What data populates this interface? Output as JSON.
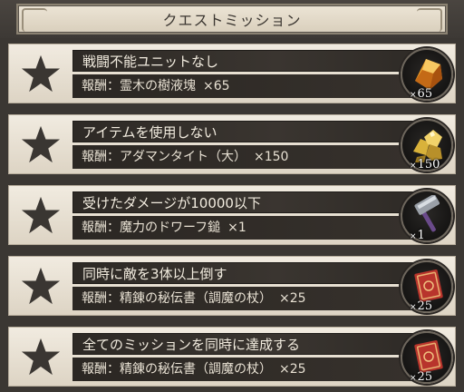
{
  "header": {
    "title": "クエストミッション"
  },
  "missions": [
    {
      "name": "戦闘不能ユニットなし",
      "reward_prefix": "報酬：",
      "reward_item": "霊木の樹液塊",
      "reward_qty": "×65",
      "icon": "amber-crystal-icon",
      "count_x": "×",
      "count": "65"
    },
    {
      "name": "アイテムを使用しない",
      "reward_prefix": "報酬：",
      "reward_item": "アダマンタイト（大）",
      "reward_qty": "×150",
      "icon": "gold-ore-icon",
      "count_x": "×",
      "count": "150"
    },
    {
      "name": "受けたダメージが10000以下",
      "reward_prefix": "報酬：",
      "reward_item": "魔力のドワーフ鎚",
      "reward_qty": "×1",
      "icon": "hammer-icon",
      "count_x": "×",
      "count": "1"
    },
    {
      "name": "同時に敵を3体以上倒す",
      "reward_prefix": "報酬：",
      "reward_item": "精錬の秘伝書（調魔の杖）",
      "reward_qty": "×25",
      "icon": "red-book-icon",
      "count_x": "×",
      "count": "25"
    },
    {
      "name": "全てのミッションを同時に達成する",
      "reward_prefix": "報酬：",
      "reward_item": "精錬の秘伝書（調魔の杖）",
      "reward_qty": "×25",
      "icon": "red-book-icon",
      "count_x": "×",
      "count": "25"
    }
  ],
  "colors": {
    "star": "#3a3632",
    "name_bar": "#2d2925",
    "panel": "#e9e2d5"
  }
}
